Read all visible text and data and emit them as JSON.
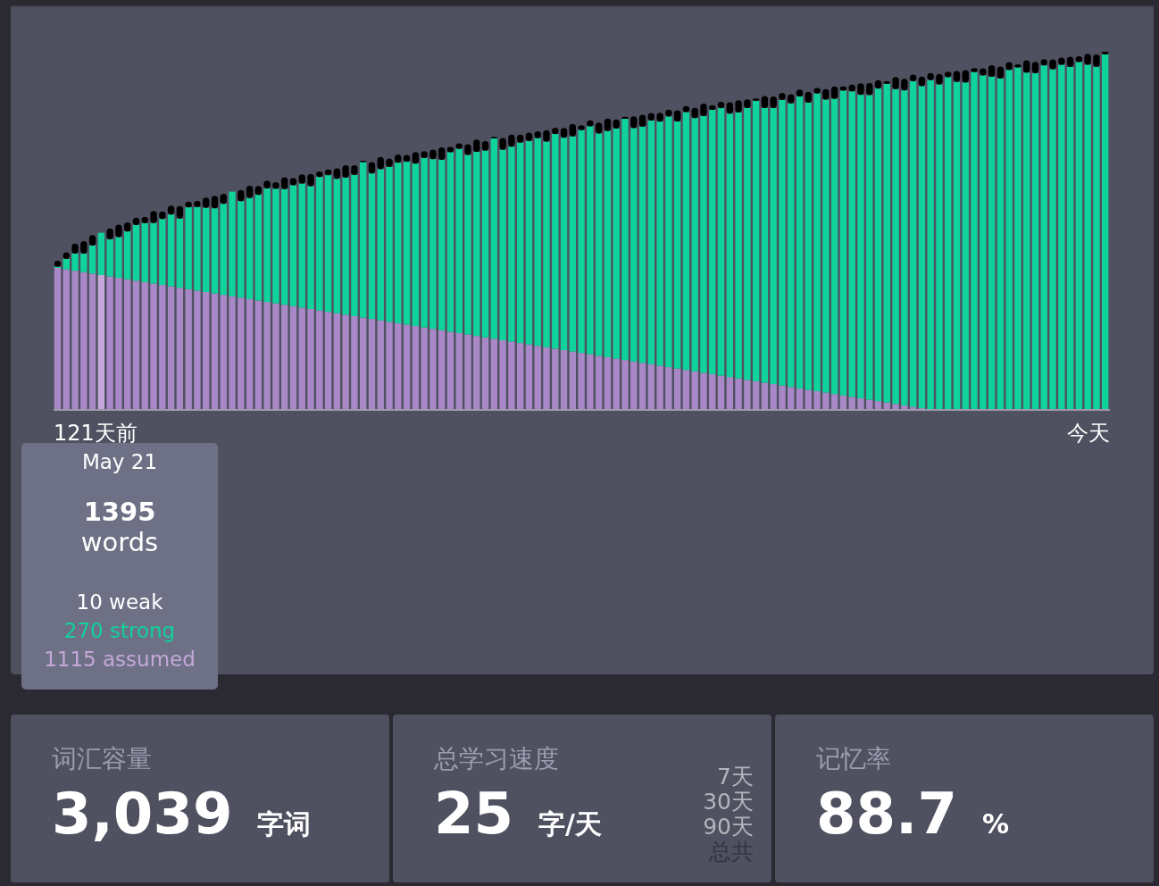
{
  "chart": {
    "start_label": "121天前",
    "end_label": "今天"
  },
  "tooltip": {
    "date": "May 21",
    "total": "1395",
    "total_unit": "words",
    "breakdown": [
      {
        "text": "10 weak",
        "color": "#ffffff"
      },
      {
        "text": "270 strong",
        "color": "#0fd39b"
      },
      {
        "text": "1115 assumed",
        "color": "#c3a8d9"
      }
    ]
  },
  "cards": [
    {
      "kind": "plain",
      "title": "词汇容量",
      "value": "3,039",
      "unit": "字词"
    },
    {
      "kind": "periods",
      "title": "总学习速度",
      "value": "25",
      "unit": "字/天",
      "periods": [
        {
          "label": "7天",
          "selected": false
        },
        {
          "label": "30天",
          "selected": false
        },
        {
          "label": "90天",
          "selected": false
        },
        {
          "label": "总共",
          "selected": true
        }
      ]
    },
    {
      "kind": "plain",
      "title": "记忆率",
      "value": "88.7",
      "unit": "%"
    }
  ]
}
